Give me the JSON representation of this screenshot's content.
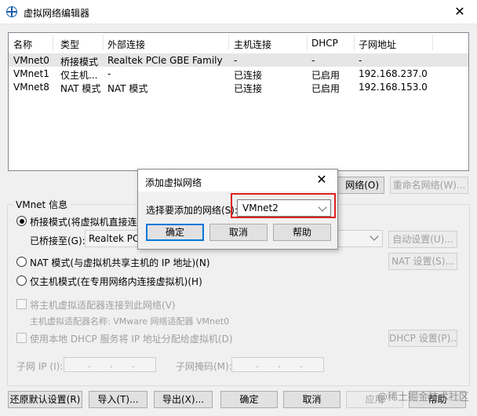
{
  "window": {
    "title": "虚拟网络编辑器"
  },
  "table": {
    "columns": [
      "名称",
      "类型",
      "外部连接",
      "主机连接",
      "DHCP",
      "子网地址"
    ],
    "rows": [
      {
        "name": "VMnet0",
        "type": "桥接模式",
        "external": "Realtek PCIe GBE Family Co...",
        "host": "-",
        "dhcp": "-",
        "subnet": "-"
      },
      {
        "name": "VMnet1",
        "type": "仅主机...",
        "external": "-",
        "host": "已连接",
        "dhcp": "已启用",
        "subnet": "192.168.237.0"
      },
      {
        "name": "VMnet8",
        "type": "NAT 模式",
        "external": "NAT 模式",
        "host": "已连接",
        "dhcp": "已启用",
        "subnet": "192.168.153.0"
      }
    ]
  },
  "actions": {
    "remove_network_partial": "网络(O)",
    "rename_network": "重命名网络(W)..."
  },
  "vmnet_info": {
    "group_title": "VMnet 信息",
    "bridged_label": "桥接模式(将虚拟机直接连接",
    "bridged_to_label": "已桥接至(G):",
    "bridged_to_value": "Realtek PCIe",
    "auto_settings": "自动设置(U)...",
    "nat_label": "NAT 模式(与虚拟机共享主机的 IP 地址)(N)",
    "nat_settings": "NAT 设置(S)...",
    "hostonly_label": "仅主机模式(在专用网络内连接虚拟机)(H)",
    "connect_adapter_label": "将主机虚拟适配器连接到此网络(V)",
    "adapter_name_label": "主机虚拟适配器名称: VMware 网络适配器 VMnet0",
    "dhcp_label": "使用本地 DHCP 服务将 IP 地址分配给虚拟机(D)",
    "dhcp_settings": "DHCP 设置(P)...",
    "subnet_ip_label": "子网 IP (I):",
    "subnet_mask_label": "子网掩码(M):"
  },
  "footer": {
    "restore_defaults": "还原默认设置(R)",
    "import": "导入(T)...",
    "export": "导出(X)...",
    "ok": "确定",
    "cancel": "取消",
    "apply": "应用",
    "help": "帮助"
  },
  "dialog": {
    "title": "添加虚拟网络",
    "select_label": "选择要添加的网络(S):",
    "selected_value": "VMnet2",
    "ok": "确定",
    "cancel": "取消",
    "help": "帮助"
  },
  "watermark": "@稀土掘金技术社区",
  "colors": {
    "highlight_border": "#e02020",
    "default_button_border": "#0078d7",
    "selected_row": "#e6e6e6"
  },
  "icons": {
    "app": "network-globe-icon",
    "close": "close-icon",
    "dropdown": "chevron-down-icon"
  }
}
